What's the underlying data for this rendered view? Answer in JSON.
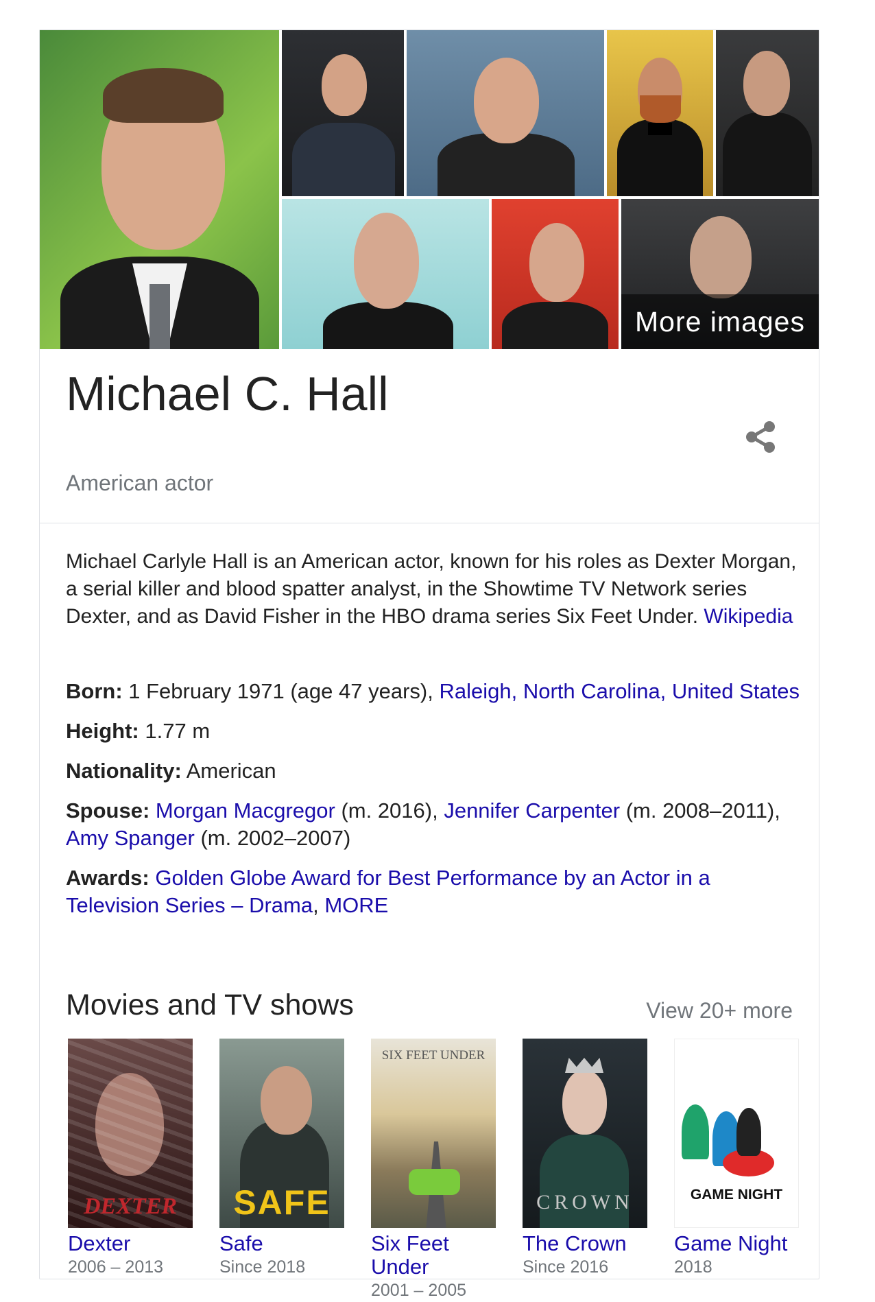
{
  "images": {
    "more_label": "More images"
  },
  "entity": {
    "name": "Michael C. Hall",
    "subtitle": "American actor"
  },
  "description": {
    "text": "Michael Carlyle Hall is an American actor, known for his roles as Dexter Morgan, a serial killer and blood spatter analyst, in the Showtime TV Network series Dexter, and as David Fisher in the HBO drama series Six Feet Under. ",
    "source": "Wikipedia"
  },
  "facts": {
    "born": {
      "label": "Born:",
      "text": " 1 February 1971 (age 47 years), ",
      "link": "Raleigh, North Carolina, United States"
    },
    "height": {
      "label": "Height:",
      "value": " 1.77 m"
    },
    "nationality": {
      "label": "Nationality:",
      "value": " American"
    },
    "spouse": {
      "label": "Spouse:",
      "s1": "Morgan Macgregor",
      "s1_note": " (m. 2016), ",
      "s2": "Jennifer Carpenter",
      "s2_note": " (m. 2008–2011), ",
      "s3": "Amy Spanger",
      "s3_note": " (m. 2002–2007)"
    },
    "awards": {
      "label": "Awards:",
      "award": "Golden Globe Award for Best Performance by an Actor in a Television Series – Drama",
      "sep": ", ",
      "more": "MORE"
    }
  },
  "movies": {
    "section_title": "Movies and TV shows",
    "view_more": "View 20+ more",
    "items": [
      {
        "title": "Dexter",
        "years": "2006 – 2013",
        "poster_text": "DEXTER"
      },
      {
        "title": "Safe",
        "years": "Since 2018",
        "poster_text": "SAFE"
      },
      {
        "title": "Six Feet Under",
        "years": "2001 – 2005",
        "poster_text": "SIX FEET UNDER"
      },
      {
        "title": "The Crown",
        "years": "Since 2016",
        "poster_text": "CROWN"
      },
      {
        "title": "Game Night",
        "years": "2018",
        "poster_text": "GAME NIGHT"
      }
    ]
  },
  "icons": {
    "share": "share-icon"
  },
  "colors": {
    "link": "#1a0dab",
    "muted": "#70757a",
    "text": "#222222"
  }
}
